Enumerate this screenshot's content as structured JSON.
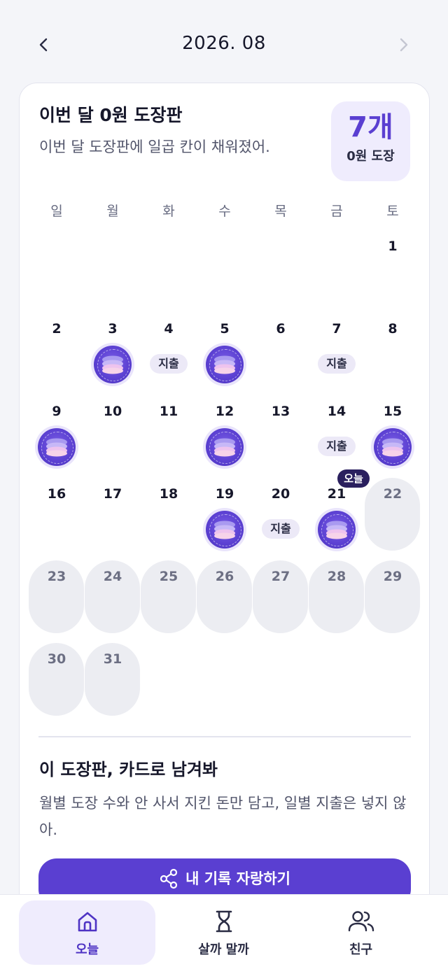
{
  "header": {
    "month": "2026. 08",
    "prev_icon": "chevron-left-icon",
    "next_icon": "chevron-right-icon"
  },
  "card": {
    "title": "이번 달 0원 도장판",
    "subtitle": "이번 달 도장판에 일곱 칸이 채워졌어.",
    "count": "7개",
    "count_label": "0원 도장"
  },
  "calendar": {
    "weekdays": [
      "일",
      "월",
      "화",
      "수",
      "목",
      "금",
      "토"
    ],
    "spend_label": "지출",
    "today_label": "오늘",
    "weeks": [
      [
        null,
        null,
        null,
        null,
        null,
        null,
        {
          "day": "1",
          "status": "none"
        }
      ],
      [
        {
          "day": "2",
          "status": "none"
        },
        {
          "day": "3",
          "status": "stamp"
        },
        {
          "day": "4",
          "status": "spend"
        },
        {
          "day": "5",
          "status": "stamp"
        },
        {
          "day": "6",
          "status": "none"
        },
        {
          "day": "7",
          "status": "spend"
        },
        {
          "day": "8",
          "status": "none"
        }
      ],
      [
        {
          "day": "9",
          "status": "stamp"
        },
        {
          "day": "10",
          "status": "none"
        },
        {
          "day": "11",
          "status": "none"
        },
        {
          "day": "12",
          "status": "stamp"
        },
        {
          "day": "13",
          "status": "none"
        },
        {
          "day": "14",
          "status": "spend"
        },
        {
          "day": "15",
          "status": "stamp"
        }
      ],
      [
        {
          "day": "16",
          "status": "none"
        },
        {
          "day": "17",
          "status": "none"
        },
        {
          "day": "18",
          "status": "none"
        },
        {
          "day": "19",
          "status": "stamp"
        },
        {
          "day": "20",
          "status": "spend"
        },
        {
          "day": "21",
          "status": "stamp",
          "today": true
        },
        {
          "day": "22",
          "status": "future"
        }
      ],
      [
        {
          "day": "23",
          "status": "future"
        },
        {
          "day": "24",
          "status": "future"
        },
        {
          "day": "25",
          "status": "future"
        },
        {
          "day": "26",
          "status": "future"
        },
        {
          "day": "27",
          "status": "future"
        },
        {
          "day": "28",
          "status": "future"
        },
        {
          "day": "29",
          "status": "future"
        }
      ],
      [
        {
          "day": "30",
          "status": "future"
        },
        {
          "day": "31",
          "status": "future"
        },
        null,
        null,
        null,
        null,
        null
      ]
    ]
  },
  "share": {
    "title": "이 도장판, 카드로 남겨봐",
    "description": "월별 도장 수와 안 사서 지킨 돈만 담고, 일별 지출은 넣지 않아.",
    "button_label": "내 기록 자랑하기",
    "button_icon": "share-icon"
  },
  "bottom_nav": {
    "tabs": [
      {
        "label": "오늘",
        "icon": "home-icon",
        "active": true
      },
      {
        "label": "살까 말까",
        "icon": "hourglass-icon",
        "active": false
      },
      {
        "label": "친구",
        "icon": "friends-icon",
        "active": false
      }
    ]
  },
  "colors": {
    "accent": "#5a3fd1",
    "accent_soft": "#efecfd",
    "background": "#f4f5f9"
  }
}
